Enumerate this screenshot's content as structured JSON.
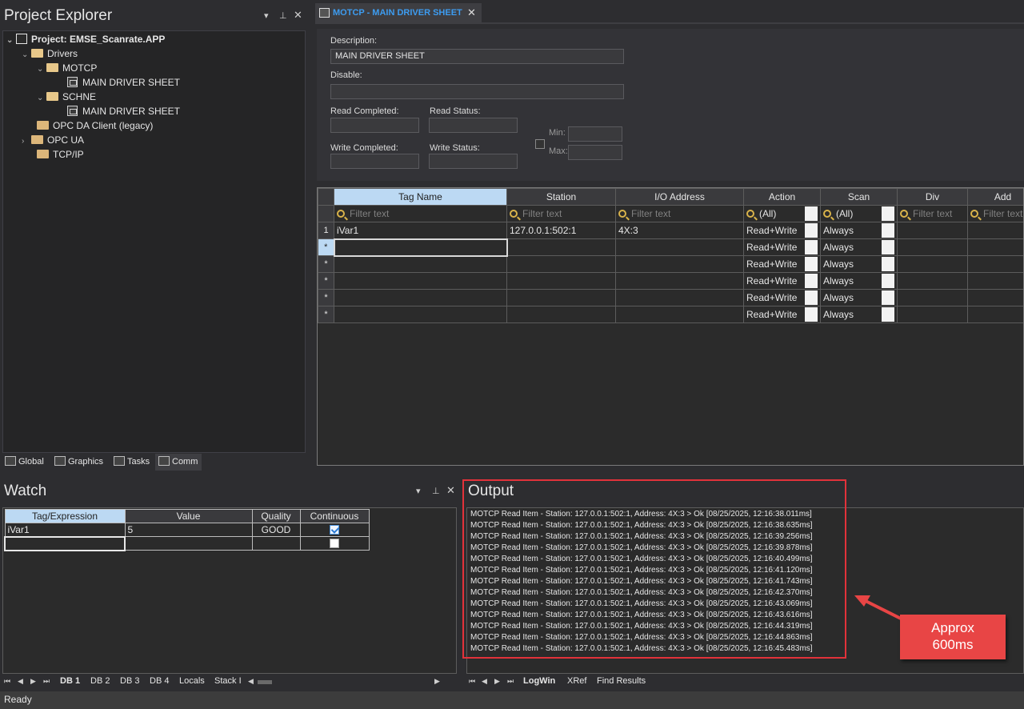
{
  "project_explorer": {
    "title": "Project Explorer",
    "tree": [
      {
        "label": "Project: EMSE_Scanrate.APP",
        "icon": "project-icon",
        "bold": true
      },
      {
        "label": "Drivers",
        "icon": "folder-open-icon"
      },
      {
        "label": "MOTCP",
        "icon": "folder-open-icon"
      },
      {
        "label": "MAIN DRIVER SHEET",
        "icon": "sheet-icon"
      },
      {
        "label": "SCHNE",
        "icon": "folder-open-icon"
      },
      {
        "label": "MAIN DRIVER SHEET",
        "icon": "sheet-icon"
      },
      {
        "label": "OPC DA Client (legacy)",
        "icon": "folder-icon"
      },
      {
        "label": "OPC UA",
        "icon": "folder-icon"
      },
      {
        "label": "TCP/IP",
        "icon": "folder-icon"
      }
    ],
    "tabs": [
      "Global",
      "Graphics",
      "Tasks",
      "Comm"
    ]
  },
  "document": {
    "tab_title": "MOTCP - MAIN DRIVER SHEET",
    "form": {
      "description_label": "Description:",
      "description_value": "MAIN DRIVER SHEET",
      "disable_label": "Disable:",
      "disable_value": "",
      "read_completed_label": "Read Completed:",
      "read_status_label": "Read Status:",
      "write_completed_label": "Write Completed:",
      "write_status_label": "Write Status:",
      "min_label": "Min:",
      "max_label": "Max:"
    },
    "grid": {
      "columns": [
        "Tag Name",
        "Station",
        "I/O Address",
        "Action",
        "Scan",
        "Div",
        "Add"
      ],
      "filter_placeholder": "Filter text",
      "filter_all": "(All)",
      "rows": [
        {
          "hdr": "1",
          "tag": "iVar1",
          "station": "127.0.0.1:502:1",
          "address": "4X:3",
          "action": "Read+Write",
          "scan": "Always"
        },
        {
          "hdr": "*",
          "tag": "",
          "station": "",
          "address": "",
          "action": "Read+Write",
          "scan": "Always"
        },
        {
          "hdr": "*",
          "tag": "",
          "station": "",
          "address": "",
          "action": "Read+Write",
          "scan": "Always"
        },
        {
          "hdr": "*",
          "tag": "",
          "station": "",
          "address": "",
          "action": "Read+Write",
          "scan": "Always"
        },
        {
          "hdr": "*",
          "tag": "",
          "station": "",
          "address": "",
          "action": "Read+Write",
          "scan": "Always"
        },
        {
          "hdr": "*",
          "tag": "",
          "station": "",
          "address": "",
          "action": "Read+Write",
          "scan": "Always"
        }
      ]
    }
  },
  "watch": {
    "title": "Watch",
    "columns": [
      "Tag/Expression",
      "Value",
      "Quality",
      "Continuous"
    ],
    "rows": [
      {
        "tag": "iVar1",
        "value": "5",
        "quality": "GOOD",
        "continuous": true
      },
      {
        "tag": "",
        "value": "",
        "quality": "",
        "continuous": false
      }
    ],
    "tabs": [
      "DB 1",
      "DB 2",
      "DB 3",
      "DB 4",
      "Locals",
      "Stack I"
    ]
  },
  "output": {
    "title": "Output",
    "lines": [
      "MOTCP Read Item - Station: 127.0.0.1:502:1, Address: 4X:3 > Ok [08/25/2025, 12:16:38.011ms]",
      "MOTCP Read Item - Station: 127.0.0.1:502:1, Address: 4X:3 > Ok [08/25/2025, 12:16:38.635ms]",
      "MOTCP Read Item - Station: 127.0.0.1:502:1, Address: 4X:3 > Ok [08/25/2025, 12:16:39.256ms]",
      "MOTCP Read Item - Station: 127.0.0.1:502:1, Address: 4X:3 > Ok [08/25/2025, 12:16:39.878ms]",
      "MOTCP Read Item - Station: 127.0.0.1:502:1, Address: 4X:3 > Ok [08/25/2025, 12:16:40.499ms]",
      "MOTCP Read Item - Station: 127.0.0.1:502:1, Address: 4X:3 > Ok [08/25/2025, 12:16:41.120ms]",
      "MOTCP Read Item - Station: 127.0.0.1:502:1, Address: 4X:3 > Ok [08/25/2025, 12:16:41.743ms]",
      "MOTCP Read Item - Station: 127.0.0.1:502:1, Address: 4X:3 > Ok [08/25/2025, 12:16:42.370ms]",
      "MOTCP Read Item - Station: 127.0.0.1:502:1, Address: 4X:3 > Ok [08/25/2025, 12:16:43.069ms]",
      "MOTCP Read Item - Station: 127.0.0.1:502:1, Address: 4X:3 > Ok [08/25/2025, 12:16:43.616ms]",
      "MOTCP Read Item - Station: 127.0.0.1:502:1, Address: 4X:3 > Ok [08/25/2025, 12:16:44.319ms]",
      "MOTCP Read Item - Station: 127.0.0.1:502:1, Address: 4X:3 > Ok [08/25/2025, 12:16:44.863ms]",
      "MOTCP Read Item - Station: 127.0.0.1:502:1, Address: 4X:3 > Ok [08/25/2025, 12:16:45.483ms]"
    ],
    "tabs": [
      "LogWin",
      "XRef",
      "Find Results"
    ],
    "callout_line1": "Approx",
    "callout_line2": "600ms"
  },
  "status": {
    "text": "Ready"
  },
  "colors": {
    "accent": "#3d9cf0",
    "highlight": "#e2323a",
    "callout": "#e84545"
  }
}
